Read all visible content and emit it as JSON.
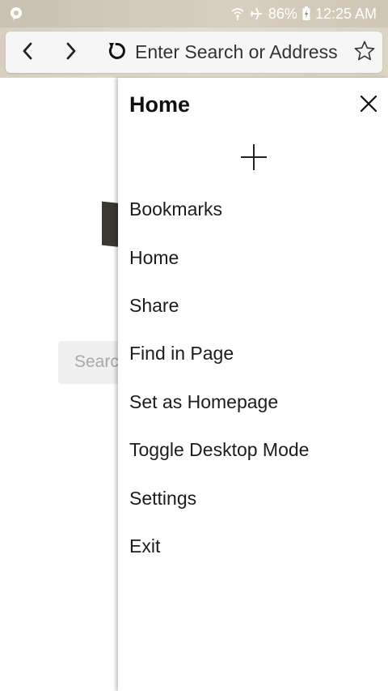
{
  "status_bar": {
    "battery_percent": "86%",
    "time": "12:25 AM",
    "icons": [
      "notification-icon",
      "wifi-icon",
      "airplane-icon",
      "battery-charging-icon"
    ]
  },
  "toolbar": {
    "back_icon": "chevron-left-icon",
    "forward_icon": "chevron-right-icon",
    "reload_icon": "reload-icon",
    "address_placeholder": "Enter Search or Address",
    "bookmark_icon": "star-outline-icon"
  },
  "background_page": {
    "search_placeholder_fragment": "Searc"
  },
  "menu": {
    "title": "Home",
    "close_icon": "close-icon",
    "add_icon": "plus-icon",
    "items": [
      {
        "label": "Bookmarks"
      },
      {
        "label": "Home"
      },
      {
        "label": "Share"
      },
      {
        "label": "Find in Page"
      },
      {
        "label": "Set as Homepage"
      },
      {
        "label": "Toggle Desktop Mode"
      },
      {
        "label": "Settings"
      },
      {
        "label": "Exit"
      }
    ]
  },
  "colors": {
    "status_bar": "#cfc6b6",
    "toolbar": "#ded5c5",
    "address_bar": "#f6f6f6",
    "menu_background": "#ffffff",
    "text": "#1c1c1c"
  }
}
